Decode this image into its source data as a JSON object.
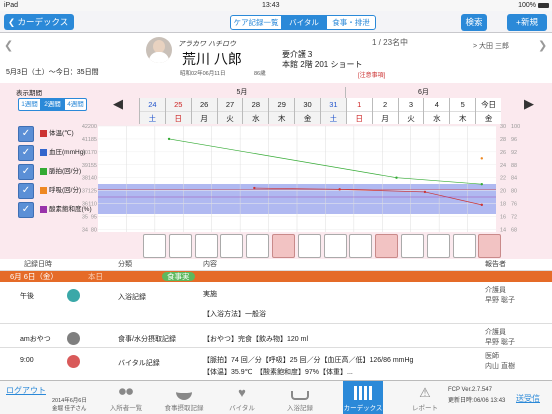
{
  "status": {
    "device": "iPad",
    "time": "13:43",
    "battery": "100%"
  },
  "nav": {
    "back": "カーデックス",
    "tabs": [
      "ケア記録一覧",
      "バイタル",
      "食事・排泄"
    ],
    "search": "検索",
    "new": "+新規"
  },
  "patient": {
    "kana": "アラカワ ハチロウ",
    "name": "荒川 八郎",
    "birth": "昭和02年06月11日",
    "age": "86歳",
    "care": "要介護３",
    "room": "本館 2階 201 ショート",
    "notes": "[注意事項]",
    "counter": "1 / 23名中",
    "next": "> 大田 三郎"
  },
  "range": {
    "text": "5月3日（土）〜今日：35日間"
  },
  "display": {
    "label": "表示期間",
    "buttons": [
      "1週間",
      "2週間",
      "4週間"
    ]
  },
  "calendar": {
    "month1": "5月",
    "month2": "6月",
    "days": [
      {
        "d": "24",
        "w": "土",
        "c": "#2255cc"
      },
      {
        "d": "25",
        "w": "日",
        "c": "#cc2222"
      },
      {
        "d": "26",
        "w": "月",
        "c": "#222"
      },
      {
        "d": "27",
        "w": "火",
        "c": "#222"
      },
      {
        "d": "28",
        "w": "水",
        "c": "#222"
      },
      {
        "d": "29",
        "w": "木",
        "c": "#222"
      },
      {
        "d": "30",
        "w": "金",
        "c": "#222"
      },
      {
        "d": "31",
        "w": "土",
        "c": "#2255cc"
      },
      {
        "d": "1",
        "w": "日",
        "c": "#cc2222"
      },
      {
        "d": "2",
        "w": "月",
        "c": "#222"
      },
      {
        "d": "3",
        "w": "火",
        "c": "#222"
      },
      {
        "d": "4",
        "w": "水",
        "c": "#222"
      },
      {
        "d": "5",
        "w": "木",
        "c": "#222"
      },
      {
        "d": "今日",
        "w": "金",
        "c": "#222"
      }
    ]
  },
  "legend": [
    {
      "label": "体温(℃)",
      "color": "#cc3333"
    },
    {
      "label": "血圧(mmHg)",
      "color": "#3366cc"
    },
    {
      "label": "脈拍(回/分)",
      "color": "#33aa33"
    },
    {
      "label": "呼吸(回/分)",
      "color": "#ee8822"
    },
    {
      "label": "酸素飽和度(%)",
      "color": "#9933aa"
    }
  ],
  "axis": {
    "left": [
      "42",
      "41",
      "40",
      "39",
      "38",
      "37",
      "36",
      "35",
      "34"
    ],
    "left2": [
      "200",
      "185",
      "170",
      "155",
      "140",
      "125",
      "110",
      "95",
      "80"
    ],
    "right": [
      "30",
      "28",
      "26",
      "24",
      "22",
      "20",
      "18",
      "16",
      "14"
    ],
    "right2": [
      "100",
      "96",
      "92",
      "88",
      "84",
      "80",
      "76",
      "72",
      "68"
    ]
  },
  "list": {
    "header": [
      "記録日時",
      "分類",
      "内容",
      "報告者"
    ],
    "day": "6月 6日（金）",
    "today": "本日",
    "filter": "食事実"
  },
  "rows": [
    {
      "time": "午後",
      "cat": "入浴記録",
      "c1": "実施",
      "c2": "【入浴方法】一般浴",
      "r1": "介護員",
      "r2": "早野 聡子",
      "dot": "#3aa8a8"
    },
    {
      "time": "amおやつ",
      "cat": "食事/水分摂取記録",
      "c1": "【おやつ】完食【飲み物】120 ml",
      "c2": "",
      "r1": "介護員",
      "r2": "早野 聡子",
      "dot": "#7f7f7f"
    },
    {
      "time": "9:00",
      "cat": "バイタル記録",
      "c1": "【脈拍】74 回／分【呼吸】25 回／分【血圧高／低】126/86 mmHg",
      "c2": "【体温】35.9℃　【酸素飽和度】97%【体重】...",
      "r1": "医師",
      "r2": "内山 直樹",
      "dot": "#d95a5a"
    }
  ],
  "footer": {
    "logout": "ログアウト",
    "date": "2014年6月6日",
    "user": "金堀 佳子さん",
    "version": "FCP Ver.2.7.547",
    "update": "更新日時:06/06 13:43",
    "send": "送受信"
  },
  "tabs": [
    "入所者一覧",
    "食事摂取記録",
    "バイタル",
    "入浴記録",
    "カーデックス",
    "レポート"
  ],
  "chart_data": {
    "type": "line",
    "x": [
      "24",
      "25",
      "26",
      "27",
      "28",
      "29",
      "30",
      "31",
      "1",
      "2",
      "3",
      "4",
      "5",
      "今日"
    ],
    "series": [
      {
        "name": "体温(℃)",
        "values": [
          null,
          null,
          null,
          null,
          null,
          37.2,
          null,
          null,
          37.1,
          null,
          null,
          36.9,
          null,
          35.9
        ]
      },
      {
        "name": "脈拍(回/分)",
        "values": [
          null,
          null,
          28,
          null,
          null,
          null,
          null,
          null,
          null,
          null,
          22,
          null,
          null,
          21
        ]
      },
      {
        "name": "呼吸(回/分)",
        "values": [
          null,
          null,
          null,
          null,
          null,
          null,
          null,
          null,
          null,
          null,
          null,
          null,
          null,
          25
        ]
      }
    ]
  }
}
